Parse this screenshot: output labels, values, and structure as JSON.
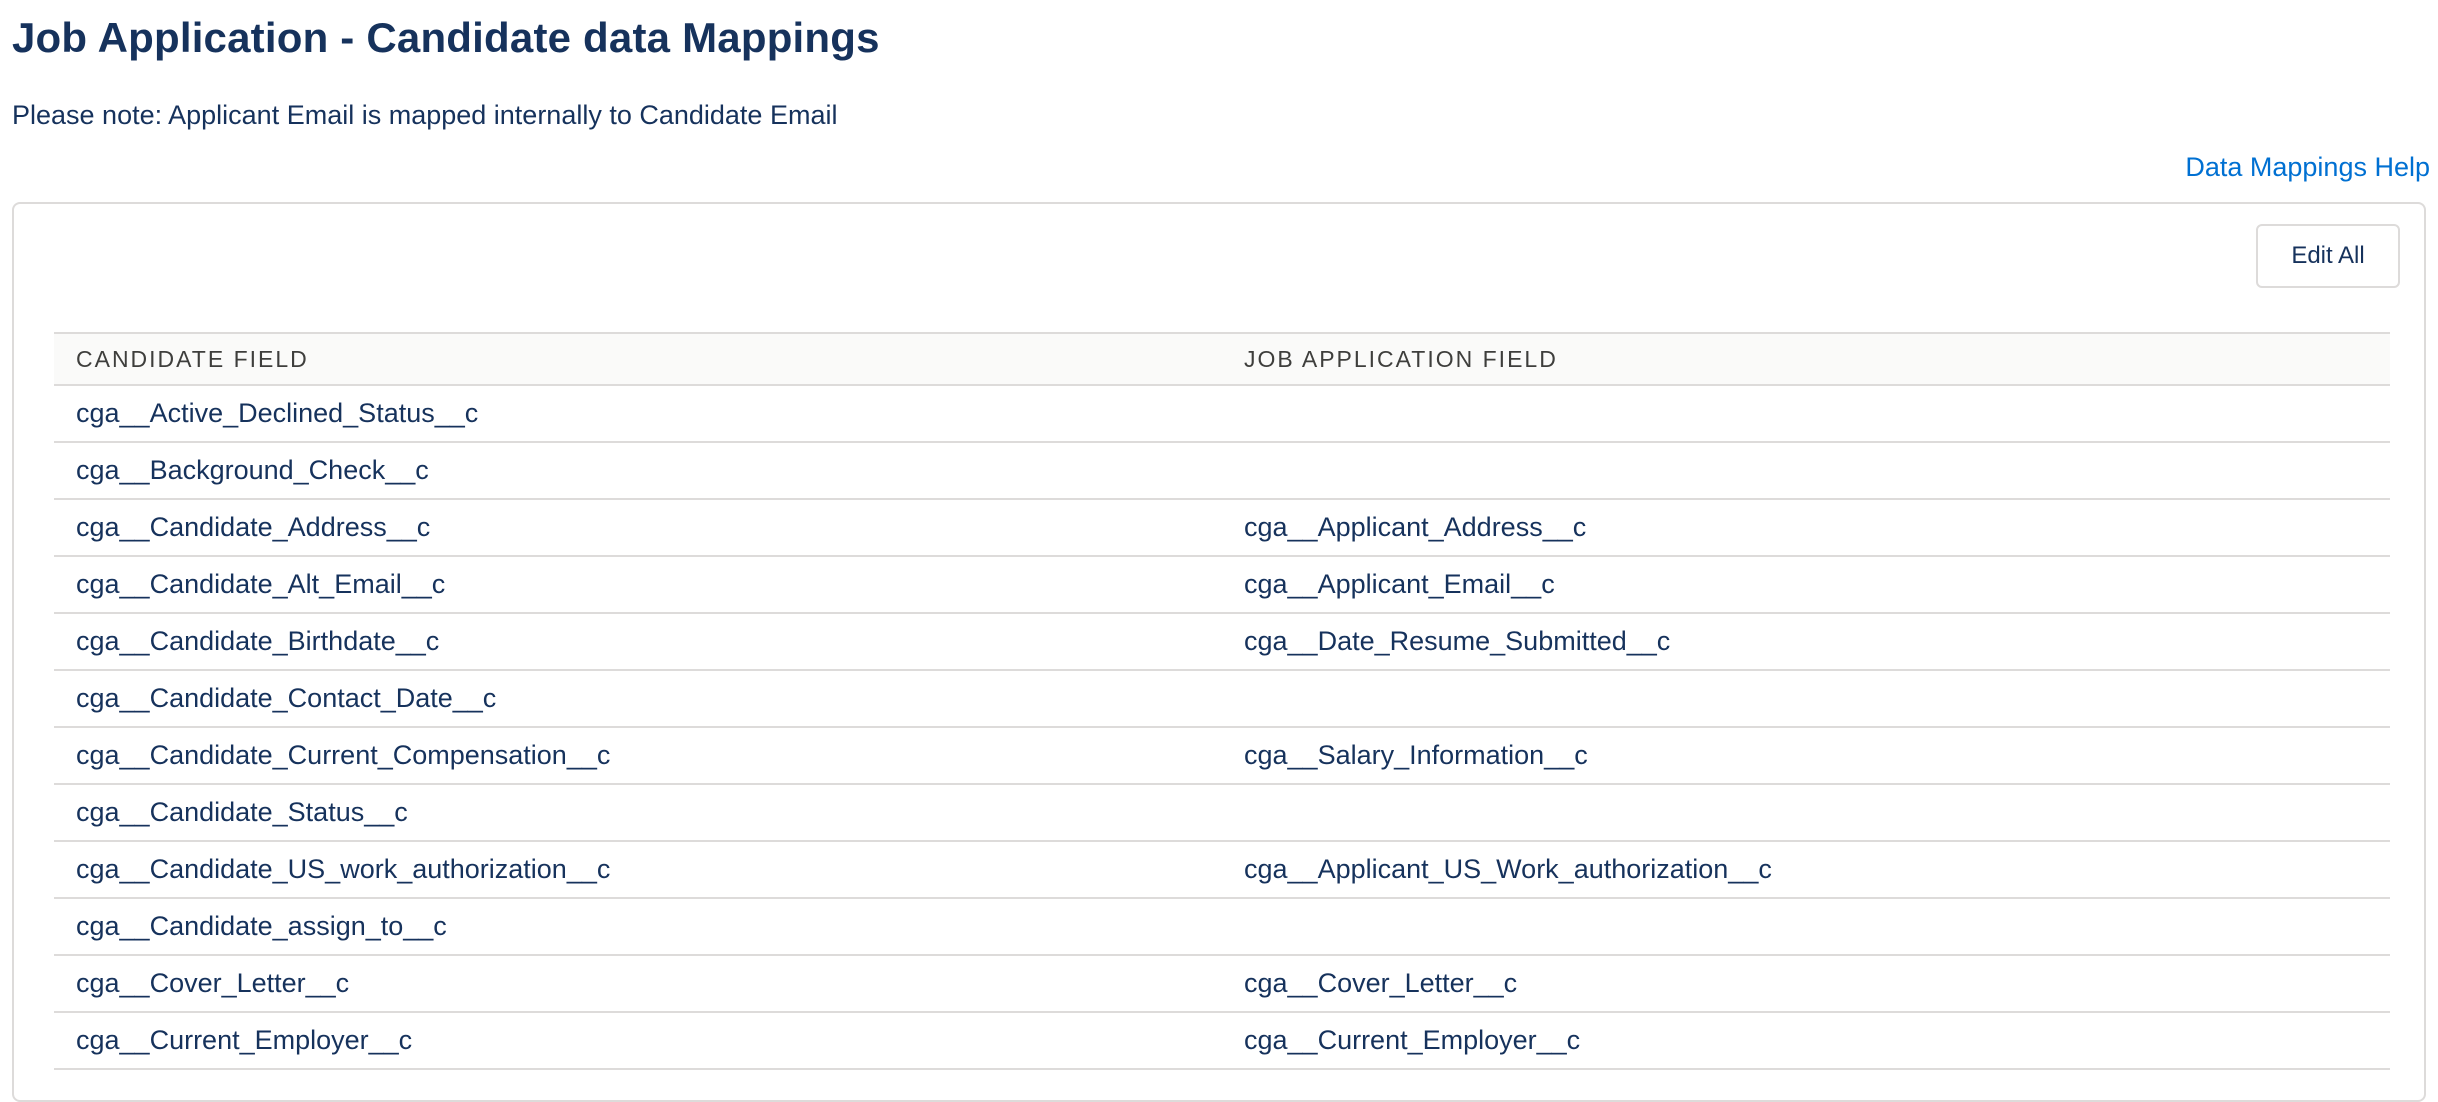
{
  "page": {
    "title": "Job Application - Candidate data Mappings",
    "note": "Please note: Applicant Email is mapped internally to Candidate Email",
    "help_link": "Data Mappings Help"
  },
  "toolbar": {
    "edit_all_label": "Edit All"
  },
  "table": {
    "headers": [
      "CANDIDATE FIELD",
      "JOB APPLICATION FIELD"
    ],
    "rows": [
      [
        "cga__Active_Declined_Status__c",
        ""
      ],
      [
        "cga__Background_Check__c",
        ""
      ],
      [
        "cga__Candidate_Address__c",
        "cga__Applicant_Address__c"
      ],
      [
        "cga__Candidate_Alt_Email__c",
        "cga__Applicant_Email__c"
      ],
      [
        "cga__Candidate_Birthdate__c",
        "cga__Date_Resume_Submitted__c"
      ],
      [
        "cga__Candidate_Contact_Date__c",
        ""
      ],
      [
        "cga__Candidate_Current_Compensation__c",
        "cga__Salary_Information__c"
      ],
      [
        "cga__Candidate_Status__c",
        ""
      ],
      [
        "cga__Candidate_US_work_authorization__c",
        "cga__Applicant_US_Work_authorization__c"
      ],
      [
        "cga__Candidate_assign_to__c",
        ""
      ],
      [
        "cga__Cover_Letter__c",
        "cga__Cover_Letter__c"
      ],
      [
        "cga__Current_Employer__c",
        "cga__Current_Employer__c"
      ]
    ]
  }
}
